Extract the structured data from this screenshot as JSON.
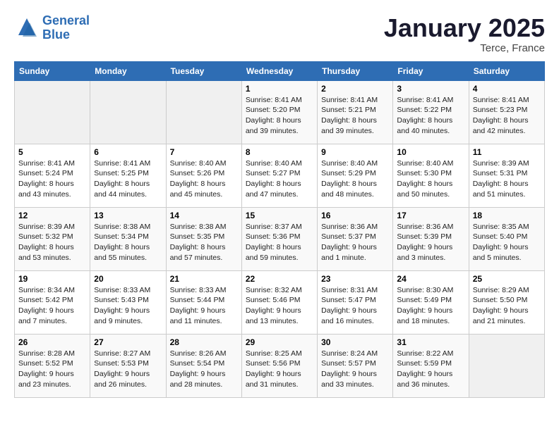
{
  "logo": {
    "line1": "General",
    "line2": "Blue"
  },
  "title": "January 2025",
  "location": "Terce, France",
  "days_header": [
    "Sunday",
    "Monday",
    "Tuesday",
    "Wednesday",
    "Thursday",
    "Friday",
    "Saturday"
  ],
  "weeks": [
    [
      {
        "day": "",
        "info": ""
      },
      {
        "day": "",
        "info": ""
      },
      {
        "day": "",
        "info": ""
      },
      {
        "day": "1",
        "info": "Sunrise: 8:41 AM\nSunset: 5:20 PM\nDaylight: 8 hours\nand 39 minutes."
      },
      {
        "day": "2",
        "info": "Sunrise: 8:41 AM\nSunset: 5:21 PM\nDaylight: 8 hours\nand 39 minutes."
      },
      {
        "day": "3",
        "info": "Sunrise: 8:41 AM\nSunset: 5:22 PM\nDaylight: 8 hours\nand 40 minutes."
      },
      {
        "day": "4",
        "info": "Sunrise: 8:41 AM\nSunset: 5:23 PM\nDaylight: 8 hours\nand 42 minutes."
      }
    ],
    [
      {
        "day": "5",
        "info": "Sunrise: 8:41 AM\nSunset: 5:24 PM\nDaylight: 8 hours\nand 43 minutes."
      },
      {
        "day": "6",
        "info": "Sunrise: 8:41 AM\nSunset: 5:25 PM\nDaylight: 8 hours\nand 44 minutes."
      },
      {
        "day": "7",
        "info": "Sunrise: 8:40 AM\nSunset: 5:26 PM\nDaylight: 8 hours\nand 45 minutes."
      },
      {
        "day": "8",
        "info": "Sunrise: 8:40 AM\nSunset: 5:27 PM\nDaylight: 8 hours\nand 47 minutes."
      },
      {
        "day": "9",
        "info": "Sunrise: 8:40 AM\nSunset: 5:29 PM\nDaylight: 8 hours\nand 48 minutes."
      },
      {
        "day": "10",
        "info": "Sunrise: 8:40 AM\nSunset: 5:30 PM\nDaylight: 8 hours\nand 50 minutes."
      },
      {
        "day": "11",
        "info": "Sunrise: 8:39 AM\nSunset: 5:31 PM\nDaylight: 8 hours\nand 51 minutes."
      }
    ],
    [
      {
        "day": "12",
        "info": "Sunrise: 8:39 AM\nSunset: 5:32 PM\nDaylight: 8 hours\nand 53 minutes."
      },
      {
        "day": "13",
        "info": "Sunrise: 8:38 AM\nSunset: 5:34 PM\nDaylight: 8 hours\nand 55 minutes."
      },
      {
        "day": "14",
        "info": "Sunrise: 8:38 AM\nSunset: 5:35 PM\nDaylight: 8 hours\nand 57 minutes."
      },
      {
        "day": "15",
        "info": "Sunrise: 8:37 AM\nSunset: 5:36 PM\nDaylight: 8 hours\nand 59 minutes."
      },
      {
        "day": "16",
        "info": "Sunrise: 8:36 AM\nSunset: 5:37 PM\nDaylight: 9 hours\nand 1 minute."
      },
      {
        "day": "17",
        "info": "Sunrise: 8:36 AM\nSunset: 5:39 PM\nDaylight: 9 hours\nand 3 minutes."
      },
      {
        "day": "18",
        "info": "Sunrise: 8:35 AM\nSunset: 5:40 PM\nDaylight: 9 hours\nand 5 minutes."
      }
    ],
    [
      {
        "day": "19",
        "info": "Sunrise: 8:34 AM\nSunset: 5:42 PM\nDaylight: 9 hours\nand 7 minutes."
      },
      {
        "day": "20",
        "info": "Sunrise: 8:33 AM\nSunset: 5:43 PM\nDaylight: 9 hours\nand 9 minutes."
      },
      {
        "day": "21",
        "info": "Sunrise: 8:33 AM\nSunset: 5:44 PM\nDaylight: 9 hours\nand 11 minutes."
      },
      {
        "day": "22",
        "info": "Sunrise: 8:32 AM\nSunset: 5:46 PM\nDaylight: 9 hours\nand 13 minutes."
      },
      {
        "day": "23",
        "info": "Sunrise: 8:31 AM\nSunset: 5:47 PM\nDaylight: 9 hours\nand 16 minutes."
      },
      {
        "day": "24",
        "info": "Sunrise: 8:30 AM\nSunset: 5:49 PM\nDaylight: 9 hours\nand 18 minutes."
      },
      {
        "day": "25",
        "info": "Sunrise: 8:29 AM\nSunset: 5:50 PM\nDaylight: 9 hours\nand 21 minutes."
      }
    ],
    [
      {
        "day": "26",
        "info": "Sunrise: 8:28 AM\nSunset: 5:52 PM\nDaylight: 9 hours\nand 23 minutes."
      },
      {
        "day": "27",
        "info": "Sunrise: 8:27 AM\nSunset: 5:53 PM\nDaylight: 9 hours\nand 26 minutes."
      },
      {
        "day": "28",
        "info": "Sunrise: 8:26 AM\nSunset: 5:54 PM\nDaylight: 9 hours\nand 28 minutes."
      },
      {
        "day": "29",
        "info": "Sunrise: 8:25 AM\nSunset: 5:56 PM\nDaylight: 9 hours\nand 31 minutes."
      },
      {
        "day": "30",
        "info": "Sunrise: 8:24 AM\nSunset: 5:57 PM\nDaylight: 9 hours\nand 33 minutes."
      },
      {
        "day": "31",
        "info": "Sunrise: 8:22 AM\nSunset: 5:59 PM\nDaylight: 9 hours\nand 36 minutes."
      },
      {
        "day": "",
        "info": ""
      }
    ]
  ]
}
